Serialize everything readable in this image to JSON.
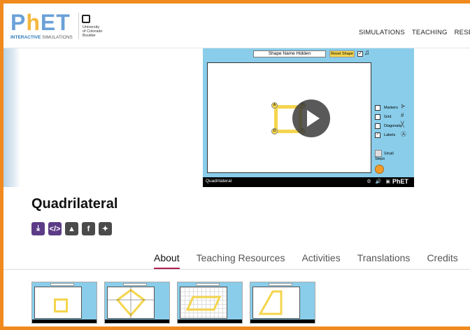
{
  "logo": {
    "word_p": "P",
    "word_h": "h",
    "word_et": "ET",
    "sub_bold": "INTERACTIVE",
    "sub_rest": " SIMULATIONS",
    "cu_line1": "University",
    "cu_line2": "of Colorado",
    "cu_line3": "Boulder"
  },
  "nav": {
    "items": [
      "SIMULATIONS",
      "TEACHING",
      "RESEA"
    ]
  },
  "sim": {
    "shape_name_label": "Shape Name Hidden",
    "reset_shape_label": "Reset Shape",
    "options": [
      {
        "label": "Markers",
        "checked": false
      },
      {
        "label": "Grid",
        "checked": false
      },
      {
        "label": "Diagonals",
        "checked": false
      },
      {
        "label": "Labels",
        "checked": true
      }
    ],
    "small_steps_label": "Small Steps",
    "bottom_title": "Quadrilateral",
    "bottom_logo": "PhET",
    "vertex_labels": [
      "A",
      "B",
      "C",
      "D"
    ]
  },
  "page": {
    "title": "Quadrilateral"
  },
  "share": {
    "icons": [
      "download-icon",
      "embed-icon",
      "share-icon",
      "facebook-icon",
      "twitter-icon"
    ]
  },
  "tabs": [
    "About",
    "Teaching Resources",
    "Activities",
    "Translations",
    "Credits"
  ],
  "thumbnails": [
    {
      "label": "Shape Name Hidden",
      "shape": "square"
    },
    {
      "label": "Kite",
      "shape": "kite"
    },
    {
      "label": "Parallelogram",
      "shape": "parallelogram"
    },
    {
      "label": "Trapezoid",
      "shape": "trapezoid"
    }
  ],
  "colors": {
    "border_orange": "#f08a1f",
    "sim_blue": "#89cdea",
    "share_purple": "#5c3c86",
    "tab_accent": "#b01e4e",
    "shape_yellow": "#f4d54d"
  }
}
